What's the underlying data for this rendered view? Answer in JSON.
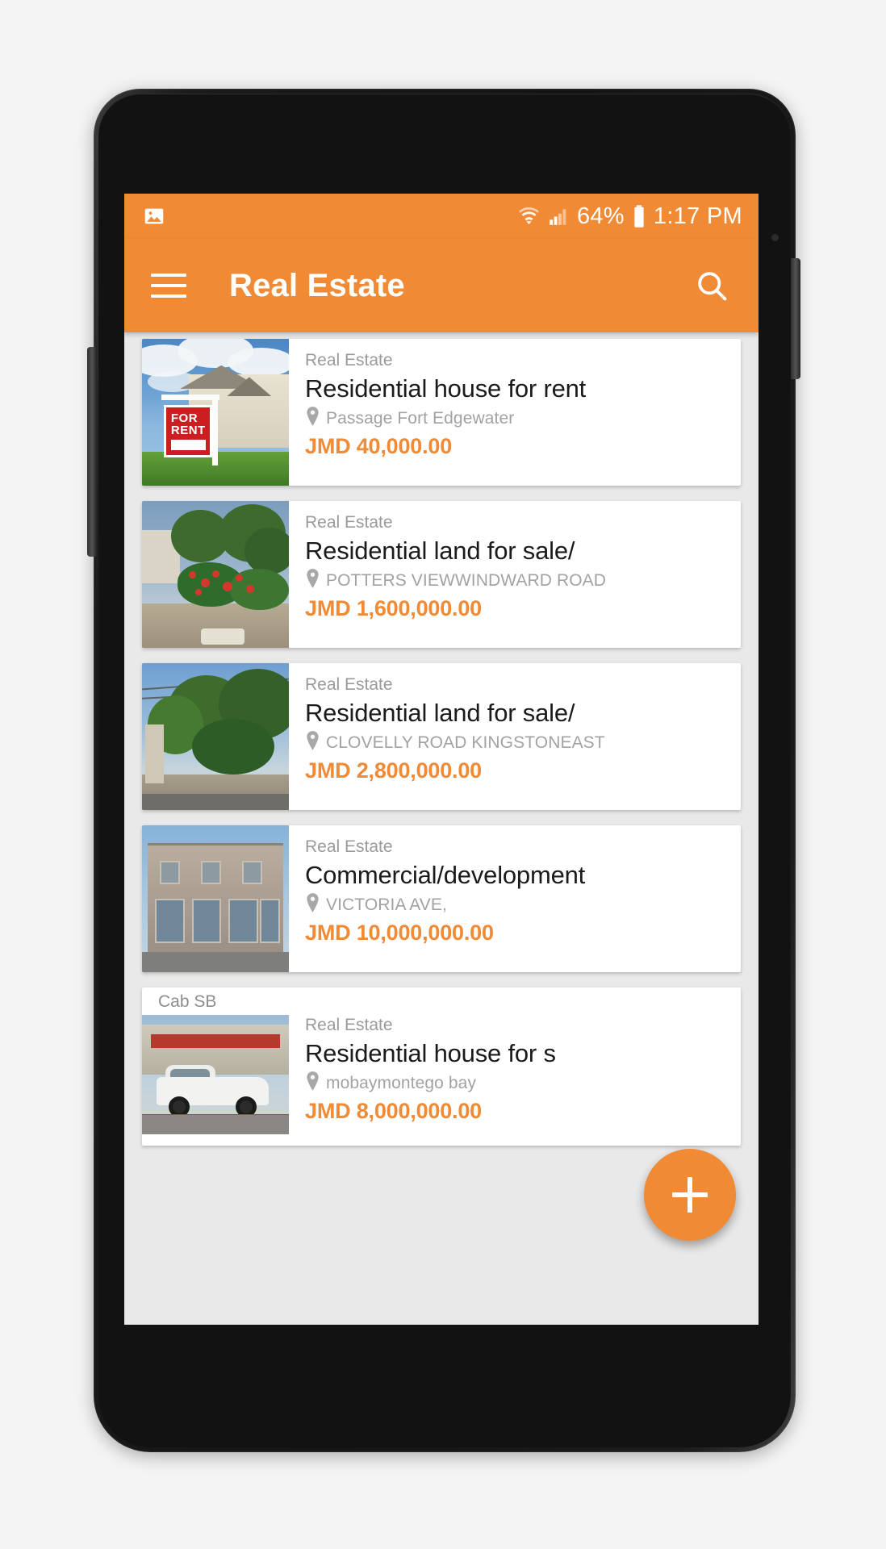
{
  "status_bar": {
    "notification_icon": "image-icon",
    "wifi_icon": "wifi-icon",
    "signal_icon": "signal-bars-icon",
    "battery_percent": "64%",
    "battery_icon": "battery-icon",
    "time": "1:17 PM"
  },
  "app_bar": {
    "menu_icon": "hamburger-menu-icon",
    "title": "Real Estate",
    "search_icon": "search-icon"
  },
  "colors": {
    "accent": "#F08A35",
    "price": "#F08A35",
    "title_text": "#1b1b1b",
    "muted_text": "#9a9a9a"
  },
  "fab": {
    "icon": "plus-icon",
    "label": "+"
  },
  "listings": [
    {
      "category": "Real Estate",
      "title": "Residential house for rent",
      "location": "Passage Fort Edgewater",
      "price": "JMD 40,000.00",
      "thumb": "house-for-rent-sign"
    },
    {
      "category": "Real Estate",
      "title": "Residential land for sale/",
      "location": "POTTERS VIEWWINDWARD ROAD",
      "price": "JMD 1,600,000.00",
      "thumb": "land-with-flowers"
    },
    {
      "category": "Real Estate",
      "title": "Residential land for sale/",
      "location": "CLOVELLY ROAD KINGSTONEAST",
      "price": "JMD 2,800,000.00",
      "thumb": "overgrown-lot"
    },
    {
      "category": "Real Estate",
      "title": "Commercial/development",
      "location": "VICTORIA AVE,",
      "price": "JMD 10,000,000.00",
      "thumb": "commercial-building"
    },
    {
      "partial_label": "Cab SB",
      "category": "Real Estate",
      "title": "Residential house for s",
      "location": "mobaymontego bay",
      "price": "JMD 8,000,000.00",
      "thumb": "white-pickup-truck"
    }
  ]
}
